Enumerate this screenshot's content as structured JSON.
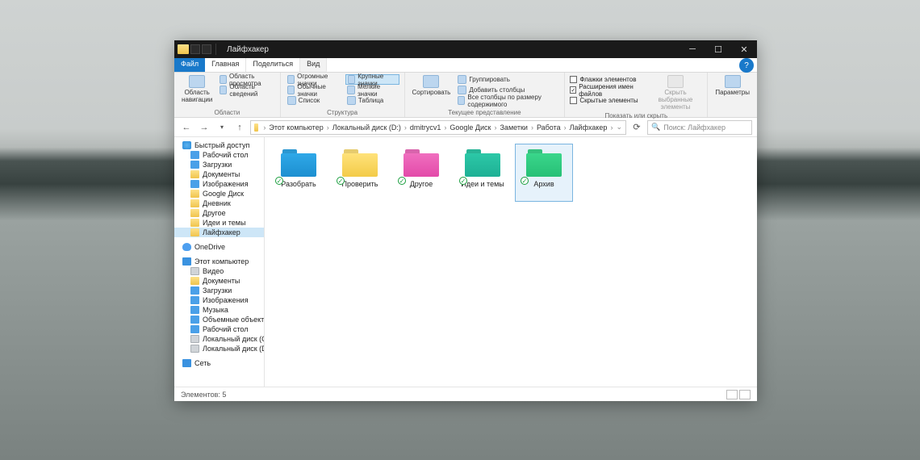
{
  "title": "Лайфхакер",
  "tabs": {
    "file": "Файл",
    "home": "Главная",
    "share": "Поделиться",
    "view": "Вид"
  },
  "ribbon": {
    "g1": {
      "navpane": "Область\nнавигации",
      "preview": "Область просмотра",
      "details": "Область сведений",
      "label": "Области"
    },
    "g2": {
      "huge": "Огромные значки",
      "large": "Крупные значки",
      "normal": "Обычные значки",
      "small": "Мелкие значки",
      "list": "Список",
      "table": "Таблица",
      "label": "Структура"
    },
    "g3": {
      "sort": "Сортировать",
      "group": "Группировать",
      "addcols": "Добавить столбцы",
      "fitcols": "Все столбцы по размеру содержимого",
      "label": "Текущее представление"
    },
    "g4": {
      "chk_flags": "Флажки элементов",
      "chk_ext": "Расширения имен файлов",
      "chk_hidden": "Скрытые элементы",
      "hidesel": "Скрыть выбранные\nэлементы",
      "label": "Показать или скрыть"
    },
    "g5": {
      "options": "Параметры",
      "label": ""
    }
  },
  "breadcrumbs": [
    "Этот компьютер",
    "Локальный диск (D:)",
    "dmitrycv1",
    "Google Диск",
    "Заметки",
    "Работа",
    "Лайфхакер"
  ],
  "search_placeholder": "Поиск: Лайфхакер",
  "sidebar": {
    "quick": {
      "hdr": "Быстрый доступ",
      "items": [
        "Рабочий стол",
        "Загрузки",
        "Документы",
        "Изображения",
        "Google Диск",
        "Дневник",
        "Другое",
        "Идеи и темы",
        "Лайфхакер"
      ]
    },
    "onedrive": "OneDrive",
    "thispc": {
      "hdr": "Этот компьютер",
      "items": [
        "Видео",
        "Документы",
        "Загрузки",
        "Изображения",
        "Музыка",
        "Объемные объекты",
        "Рабочий стол",
        "Локальный диск (C:)",
        "Локальный диск (D:)"
      ]
    },
    "network": "Сеть"
  },
  "folders": [
    {
      "name": "Разобрать",
      "color": "blue"
    },
    {
      "name": "Проверить",
      "color": "yellow"
    },
    {
      "name": "Другое",
      "color": "pink"
    },
    {
      "name": "Идеи и темы",
      "color": "teal"
    },
    {
      "name": "Архив",
      "color": "green",
      "selected": true
    }
  ],
  "status": "Элементов: 5"
}
